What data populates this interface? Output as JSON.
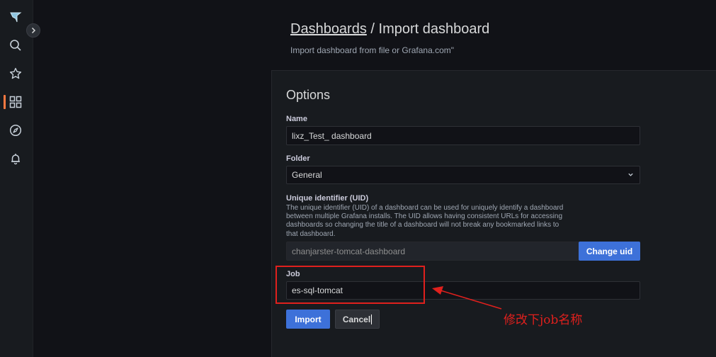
{
  "sidebar": {
    "items": [
      {
        "icon": "grafana-logo-icon"
      },
      {
        "icon": "search-icon"
      },
      {
        "icon": "star-icon"
      },
      {
        "icon": "dashboards-grid-icon",
        "active": true
      },
      {
        "icon": "compass-explore-icon"
      },
      {
        "icon": "bell-alerting-icon"
      }
    ],
    "accent_color": "#ff7941"
  },
  "header": {
    "breadcrumb_link": "Dashboards",
    "separator": " / ",
    "title": "Import dashboard",
    "subtitle": "Import dashboard from file or Grafana.com\""
  },
  "form": {
    "section_title": "Options",
    "name": {
      "label": "Name",
      "value": "lixz_Test_ dashboard"
    },
    "folder": {
      "label": "Folder",
      "value": "General"
    },
    "uid": {
      "label": "Unique identifier (UID)",
      "description": "The unique identifier (UID) of a dashboard can be used for uniquely identify a dashboard between multiple Grafana installs. The UID allows having consistent URLs for accessing dashboards so changing the title of a dashboard will not break any bookmarked links to that dashboard.",
      "value": "chanjarster-tomcat-dashboard",
      "change_button": "Change uid"
    },
    "job": {
      "label": "Job",
      "value": "es-sql-tomcat"
    },
    "import_button": "Import",
    "cancel_button": "Cancel"
  },
  "annotation": {
    "text": "修改下job名称",
    "color": "#e0201d"
  },
  "colors": {
    "primary_button": "#3d71d9",
    "background": "#111217",
    "panel": "#181b1f"
  }
}
